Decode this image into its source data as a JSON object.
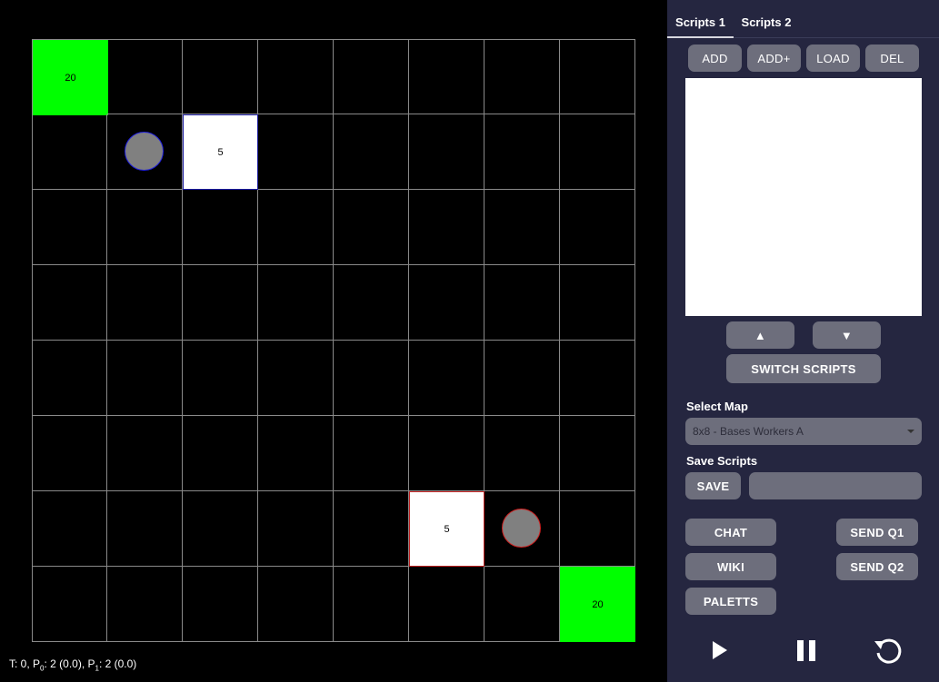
{
  "board": {
    "rows": 8,
    "cols": 8,
    "units": [
      {
        "type": "resource",
        "row": 0,
        "col": 0,
        "label": "20",
        "fill": "#00ff00",
        "border": "#00ff00"
      },
      {
        "type": "worker",
        "row": 1,
        "col": 1,
        "label": "",
        "fill": "#808080",
        "border": "#2020e0"
      },
      {
        "type": "base",
        "row": 1,
        "col": 2,
        "label": "5",
        "fill": "#ffffff",
        "border": "#1a1aa0"
      },
      {
        "type": "base",
        "row": 6,
        "col": 5,
        "label": "5",
        "fill": "#ffffff",
        "border": "#c02020"
      },
      {
        "type": "worker",
        "row": 6,
        "col": 6,
        "label": "",
        "fill": "#808080",
        "border": "#d02020"
      },
      {
        "type": "resource",
        "row": 7,
        "col": 7,
        "label": "20",
        "fill": "#00ff00",
        "border": "#00ff00"
      }
    ]
  },
  "status": {
    "prefix": "T: 0, P",
    "p0_sub": "0",
    "p0_val": ": 2 (0.0), P",
    "p1_sub": "1",
    "p1_val": ": 2 (0.0)"
  },
  "panel": {
    "tabs": [
      {
        "label": "Scripts 1"
      },
      {
        "label": "Scripts 2"
      }
    ],
    "script_buttons": {
      "add": "ADD",
      "add_plus": "ADD+",
      "load": "LOAD",
      "del": "DEL"
    },
    "move_up": "▲",
    "move_down": "▼",
    "switch_scripts": "SWITCH SCRIPTS",
    "select_map_label": "Select Map",
    "selected_map": "8x8 - Bases Workers A",
    "save_scripts_label": "Save Scripts",
    "save_button": "SAVE",
    "save_name_value": "",
    "chat": "CHAT",
    "wiki": "WIKI",
    "paletts": "PALETTS",
    "send_q1": "SEND Q1",
    "send_q2": "SEND Q2"
  },
  "controls": {
    "play_icon": "play-icon",
    "pause_icon": "pause-icon",
    "reset_icon": "reset-icon"
  }
}
